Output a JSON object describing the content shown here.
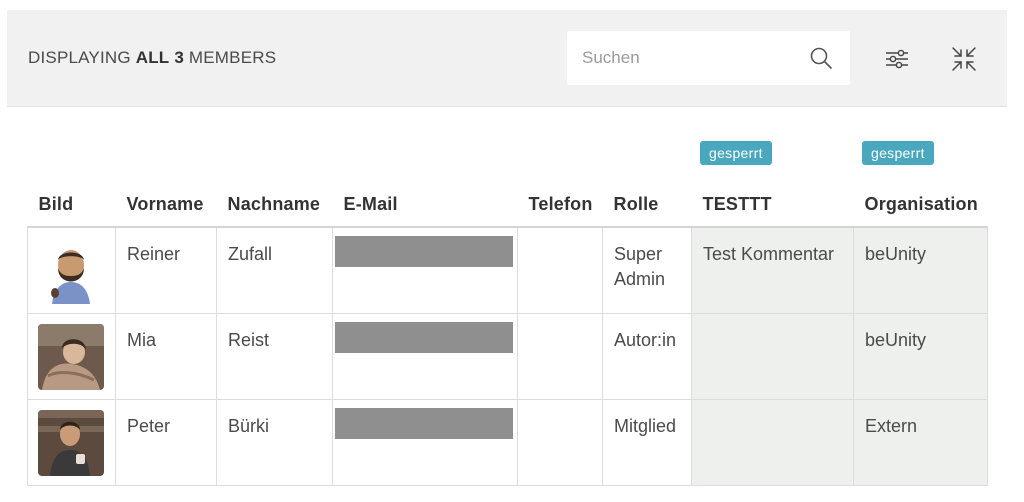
{
  "toolbar": {
    "display_prefix": "DISPLAYING",
    "display_all": "ALL",
    "display_count": "3",
    "display_suffix": "MEMBERS",
    "search_placeholder": "Suchen",
    "search_icon": "search-icon",
    "filter_icon": "sliders-icon",
    "collapse_icon": "collapse-arrows-icon"
  },
  "badges": {
    "testtt": "gesperrt",
    "organisation": "gesperrt"
  },
  "columns": [
    "Bild",
    "Vorname",
    "Nachname",
    "E-Mail",
    "Telefon",
    "Rolle",
    "TESTTT",
    "Organisation"
  ],
  "rows": [
    {
      "vorname": "Reiner",
      "nachname": "Zufall",
      "email": "",
      "telefon": "",
      "rolle": "Super Admin",
      "testtt": "Test Kommentar",
      "organisation": "beUnity"
    },
    {
      "vorname": "Mia",
      "nachname": "Reist",
      "email": "",
      "telefon": "",
      "rolle": "Autor:in",
      "testtt": "",
      "organisation": "beUnity"
    },
    {
      "vorname": "Peter",
      "nachname": "Bürki",
      "email": "",
      "telefon": "",
      "rolle": "Mitglied",
      "testtt": "",
      "organisation": "Extern"
    }
  ],
  "colors": {
    "badge": "#4aa8be",
    "toolbar_bg": "#f1f1f1",
    "shaded_column": "#eef0ee",
    "redaction": "#8f8f8f"
  }
}
